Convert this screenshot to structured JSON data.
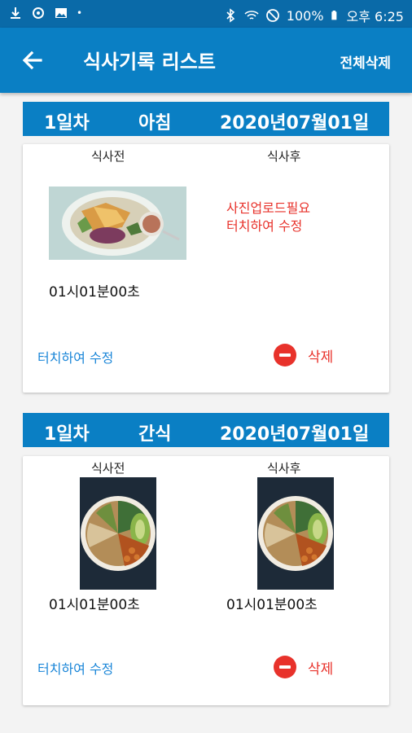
{
  "status_bar": {
    "battery": "100%",
    "time": "오후 6:25"
  },
  "app_bar": {
    "title": "식사기록 리스트",
    "action": "전체삭제"
  },
  "entries": [
    {
      "day": "1일차",
      "meal": "아침",
      "date": "2020년07월01일",
      "before_label": "식사전",
      "after_label": "식사후",
      "before_time": "01시01분00초",
      "after_notice_line1": "사진업로드필요",
      "after_notice_line2": "터치하여 수정",
      "edit_label": "터치하여 수정",
      "delete_label": "삭제"
    },
    {
      "day": "1일차",
      "meal": "간식",
      "date": "2020년07월01일",
      "before_label": "식사전",
      "after_label": "식사후",
      "before_time": "01시01분00초",
      "after_time": "01시01분00초",
      "edit_label": "터치하여 수정",
      "delete_label": "삭제"
    }
  ],
  "colors": {
    "status_bar": "#0a6aa8",
    "app_bar": "#0a7fc4",
    "delete_red": "#e8322b",
    "link_blue": "#1a86d8"
  }
}
